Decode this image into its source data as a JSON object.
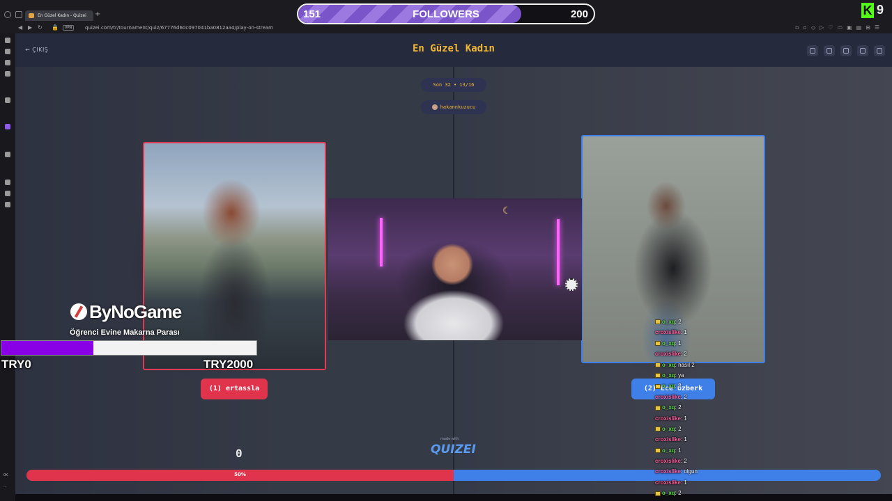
{
  "browser": {
    "tab_title": "En Güzel Kadın - Quizei",
    "new_tab": "+",
    "vpn": "VPN",
    "url": "quizei.com/tr/tournament/quiz/67776d60c097041ba0812aa4/play-on-stream"
  },
  "followers_widget": {
    "current": "151",
    "label": "FOLLOWERS",
    "goal": "200",
    "fraction": 0.755,
    "color": "#9b79e0"
  },
  "kick": {
    "logo": "K",
    "count": "9",
    "color": "#53fc18"
  },
  "page": {
    "exit_label": "← ÇIKIŞ",
    "title": "En Güzel Kadın",
    "round_label": "Son 32 • 13/16",
    "creator": "hakannkuzucu",
    "header_icons": [
      "eye-icon",
      "share-icon",
      "send-icon",
      "flag-icon",
      "fullscreen-icon"
    ],
    "left_choice": "(1) ertassla",
    "right_choice": "(2) Ece Özberk",
    "score": "0",
    "made_with": "made with",
    "brand": "QUIZEI",
    "progress_label": "50%",
    "progress_left_fraction": 0.5,
    "left_color": "#e0334c",
    "right_color": "#3f7fe8",
    "title_color": "#f2b733"
  },
  "sidebar_bottom": [
    "0K",
    "..."
  ],
  "bynogame": {
    "logo": "ByNoGame",
    "subtitle": "Öğrenci Evine Makarna Parası",
    "min": "TRY0",
    "max": "TRY2000",
    "fill_fraction": 0.36,
    "fill_color": "#8a00e6"
  },
  "chat": [
    {
      "user": "o_xq",
      "msg": ": 2",
      "color": "#66e04a",
      "badge": true
    },
    {
      "user": "croxislike",
      "msg": ": 1",
      "color": "#ff5fa0",
      "badge": false
    },
    {
      "user": "o_xq",
      "msg": ": 1",
      "color": "#66e04a",
      "badge": true
    },
    {
      "user": "croxislike",
      "msg": ": 2",
      "color": "#ff5fa0",
      "badge": false
    },
    {
      "user": "o_xq",
      "msg": ": nasıl 2",
      "color": "#66e04a",
      "badge": true
    },
    {
      "user": "o_xq",
      "msg": ": ya",
      "color": "#66e04a",
      "badge": true
    },
    {
      "user": "o_xq",
      "msg": ": 2",
      "color": "#66e04a",
      "badge": true
    },
    {
      "user": "croxislike",
      "msg": ": 2",
      "color": "#ff5fa0",
      "badge": false
    },
    {
      "user": "o_xq",
      "msg": ": 2",
      "color": "#66e04a",
      "badge": true
    },
    {
      "user": "croxislike",
      "msg": ": 1",
      "color": "#ff5fa0",
      "badge": false
    },
    {
      "user": "o_xq",
      "msg": ": 2",
      "color": "#66e04a",
      "badge": true
    },
    {
      "user": "croxislike",
      "msg": ": 1",
      "color": "#ff5fa0",
      "badge": false
    },
    {
      "user": "o_xq",
      "msg": ": 1",
      "color": "#66e04a",
      "badge": true
    },
    {
      "user": "croxislike",
      "msg": ": 2",
      "color": "#ff5fa0",
      "badge": false
    },
    {
      "user": "croxislike",
      "msg": ": olgun",
      "color": "#ff5fa0",
      "badge": false
    },
    {
      "user": "croxislike",
      "msg": ": 1",
      "color": "#ff5fa0",
      "badge": false
    },
    {
      "user": "o_xq",
      "msg": ": 2",
      "color": "#66e04a",
      "badge": true
    }
  ]
}
